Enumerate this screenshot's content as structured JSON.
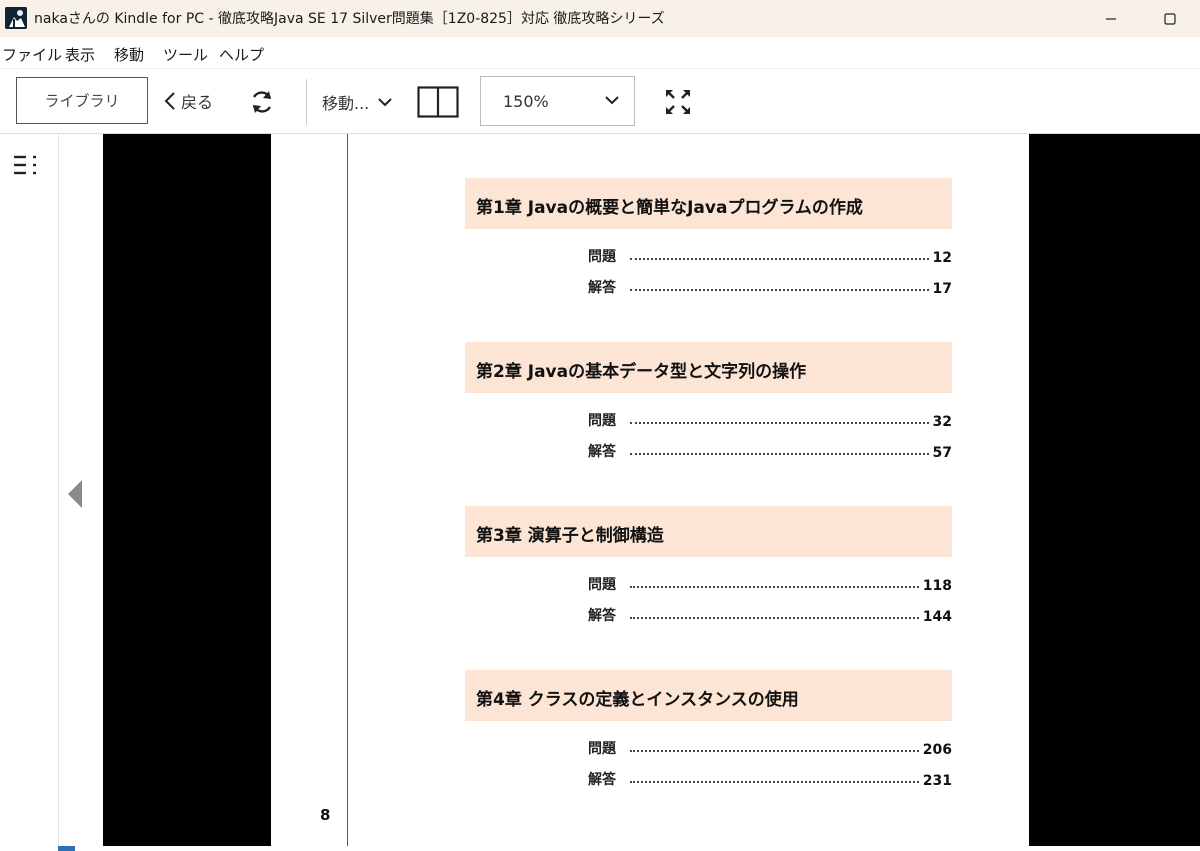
{
  "window": {
    "title": "nakaさんの Kindle for PC - 徹底攻略Java SE 17 Silver問題集［1Z0-825］対応 徹底攻略シリーズ",
    "icon": "kindle-app-icon"
  },
  "menu": {
    "items": [
      {
        "label": "ファイル"
      },
      {
        "label": "表示"
      },
      {
        "label": "移動"
      },
      {
        "label": "ツール"
      },
      {
        "label": "ヘルプ"
      }
    ]
  },
  "toolbar": {
    "library_label": "ライブラリ",
    "back_label": "戻る",
    "goto_label": "移動...",
    "zoom_value": "150%"
  },
  "book": {
    "page_number": "8",
    "chapters": [
      {
        "title": "第1章  Javaの概要と簡単なJavaプログラムの作成",
        "entries": [
          {
            "label": "問題",
            "page": "12"
          },
          {
            "label": "解答",
            "page": "17"
          }
        ]
      },
      {
        "title": "第2章  Javaの基本データ型と文字列の操作",
        "entries": [
          {
            "label": "問題",
            "page": "32"
          },
          {
            "label": "解答",
            "page": "57"
          }
        ]
      },
      {
        "title": "第3章  演算子と制御構造",
        "entries": [
          {
            "label": "問題",
            "page": "118"
          },
          {
            "label": "解答",
            "page": "144"
          }
        ]
      },
      {
        "title": "第4章  クラスの定義とインスタンスの使用",
        "entries": [
          {
            "label": "問題",
            "page": "206"
          },
          {
            "label": "解答",
            "page": "231"
          }
        ]
      }
    ]
  },
  "colors": {
    "chapter_banner": "#fde5d6",
    "titlebar_bg": "#f7f1ea",
    "accent": "#2f6fb3"
  }
}
